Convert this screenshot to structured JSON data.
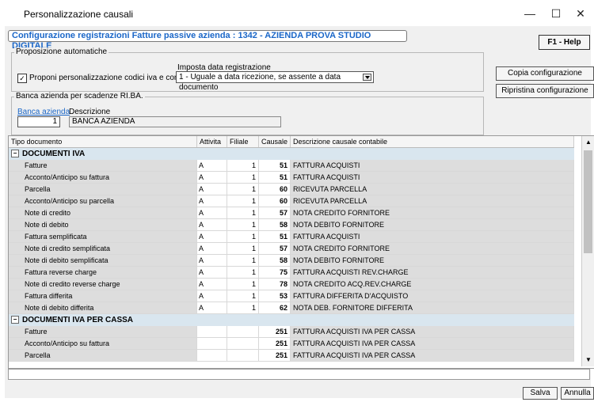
{
  "window": {
    "title": "Personalizzazione causali",
    "minimize": "—",
    "maximize": "☐",
    "close": "✕"
  },
  "header": {
    "title": "Configurazione registrazioni Fatture passive azienda  : 1342 - AZIENDA PROVA STUDIO DIGITALE",
    "help_button": "F1 - Help"
  },
  "auto": {
    "group_label": "Proposizione automatiche",
    "checkbox_label": "Proponi personalizzazione codici iva e conti",
    "checkbox_checked": true,
    "date_label": "Imposta data registrazione",
    "date_value": "1 - Uguale a data ricezione, se assente a data documento"
  },
  "buttons": {
    "copy": "Copia configurazione",
    "restore": "Ripristina configurazione",
    "save": "Salva",
    "cancel": "Annulla"
  },
  "bank": {
    "group_label": "Banca azienda per scadenze RI.BA.",
    "code_label": "Banca azienda",
    "code_value": "1",
    "desc_label": "Descrizione",
    "desc_value": "BANCA AZIENDA"
  },
  "grid": {
    "columns": [
      "Tipo documento",
      "Attivita",
      "Filiale",
      "Causale",
      "Descrizione causale contabile"
    ],
    "sections": [
      {
        "title": "DOCUMENTI IVA",
        "rows": [
          {
            "tipo": "Fatture",
            "att": "A",
            "fil": "1",
            "cau": "51",
            "desc": "FATTURA ACQUISTI"
          },
          {
            "tipo": "Acconto/Anticipo su fattura",
            "att": "A",
            "fil": "1",
            "cau": "51",
            "desc": "FATTURA ACQUISTI"
          },
          {
            "tipo": "Parcella",
            "att": "A",
            "fil": "1",
            "cau": "60",
            "desc": "RICEVUTA PARCELLA"
          },
          {
            "tipo": "Acconto/Anticipo su parcella",
            "att": "A",
            "fil": "1",
            "cau": "60",
            "desc": "RICEVUTA PARCELLA"
          },
          {
            "tipo": "Note di credito",
            "att": "A",
            "fil": "1",
            "cau": "57",
            "desc": "NOTA CREDITO FORNITORE"
          },
          {
            "tipo": "Note di debito",
            "att": "A",
            "fil": "1",
            "cau": "58",
            "desc": "NOTA DEBITO FORNITORE"
          },
          {
            "tipo": "Fattura semplificata",
            "att": "A",
            "fil": "1",
            "cau": "51",
            "desc": "FATTURA ACQUISTI"
          },
          {
            "tipo": "Note di credito semplificata",
            "att": "A",
            "fil": "1",
            "cau": "57",
            "desc": "NOTA CREDITO FORNITORE"
          },
          {
            "tipo": "Note di debito semplificata",
            "att": "A",
            "fil": "1",
            "cau": "58",
            "desc": "NOTA DEBITO FORNITORE"
          },
          {
            "tipo": "Fattura reverse charge",
            "att": "A",
            "fil": "1",
            "cau": "75",
            "desc": "FATTURA ACQUISTI REV.CHARGE"
          },
          {
            "tipo": "Note di credito reverse charge",
            "att": "A",
            "fil": "1",
            "cau": "78",
            "desc": "NOTA CREDITO ACQ.REV.CHARGE"
          },
          {
            "tipo": "Fattura differita",
            "att": "A",
            "fil": "1",
            "cau": "53",
            "desc": "FATTURA DIFFERITA D'ACQUISTO"
          },
          {
            "tipo": "Note di debito differita",
            "att": "A",
            "fil": "1",
            "cau": "62",
            "desc": "NOTA DEB. FORNITORE DIFFERITA"
          }
        ]
      },
      {
        "title": "DOCUMENTI IVA PER CASSA",
        "rows": [
          {
            "tipo": "Fatture",
            "att": "",
            "fil": "",
            "cau": "251",
            "desc": "FATTURA ACQUISTI IVA PER CASSA"
          },
          {
            "tipo": "Acconto/Anticipo su fattura",
            "att": "",
            "fil": "",
            "cau": "251",
            "desc": "FATTURA ACQUISTI IVA PER CASSA"
          },
          {
            "tipo": "Parcella",
            "att": "",
            "fil": "",
            "cau": "251",
            "desc": "FATTURA ACQUISTI IVA PER CASSA"
          }
        ]
      }
    ]
  }
}
